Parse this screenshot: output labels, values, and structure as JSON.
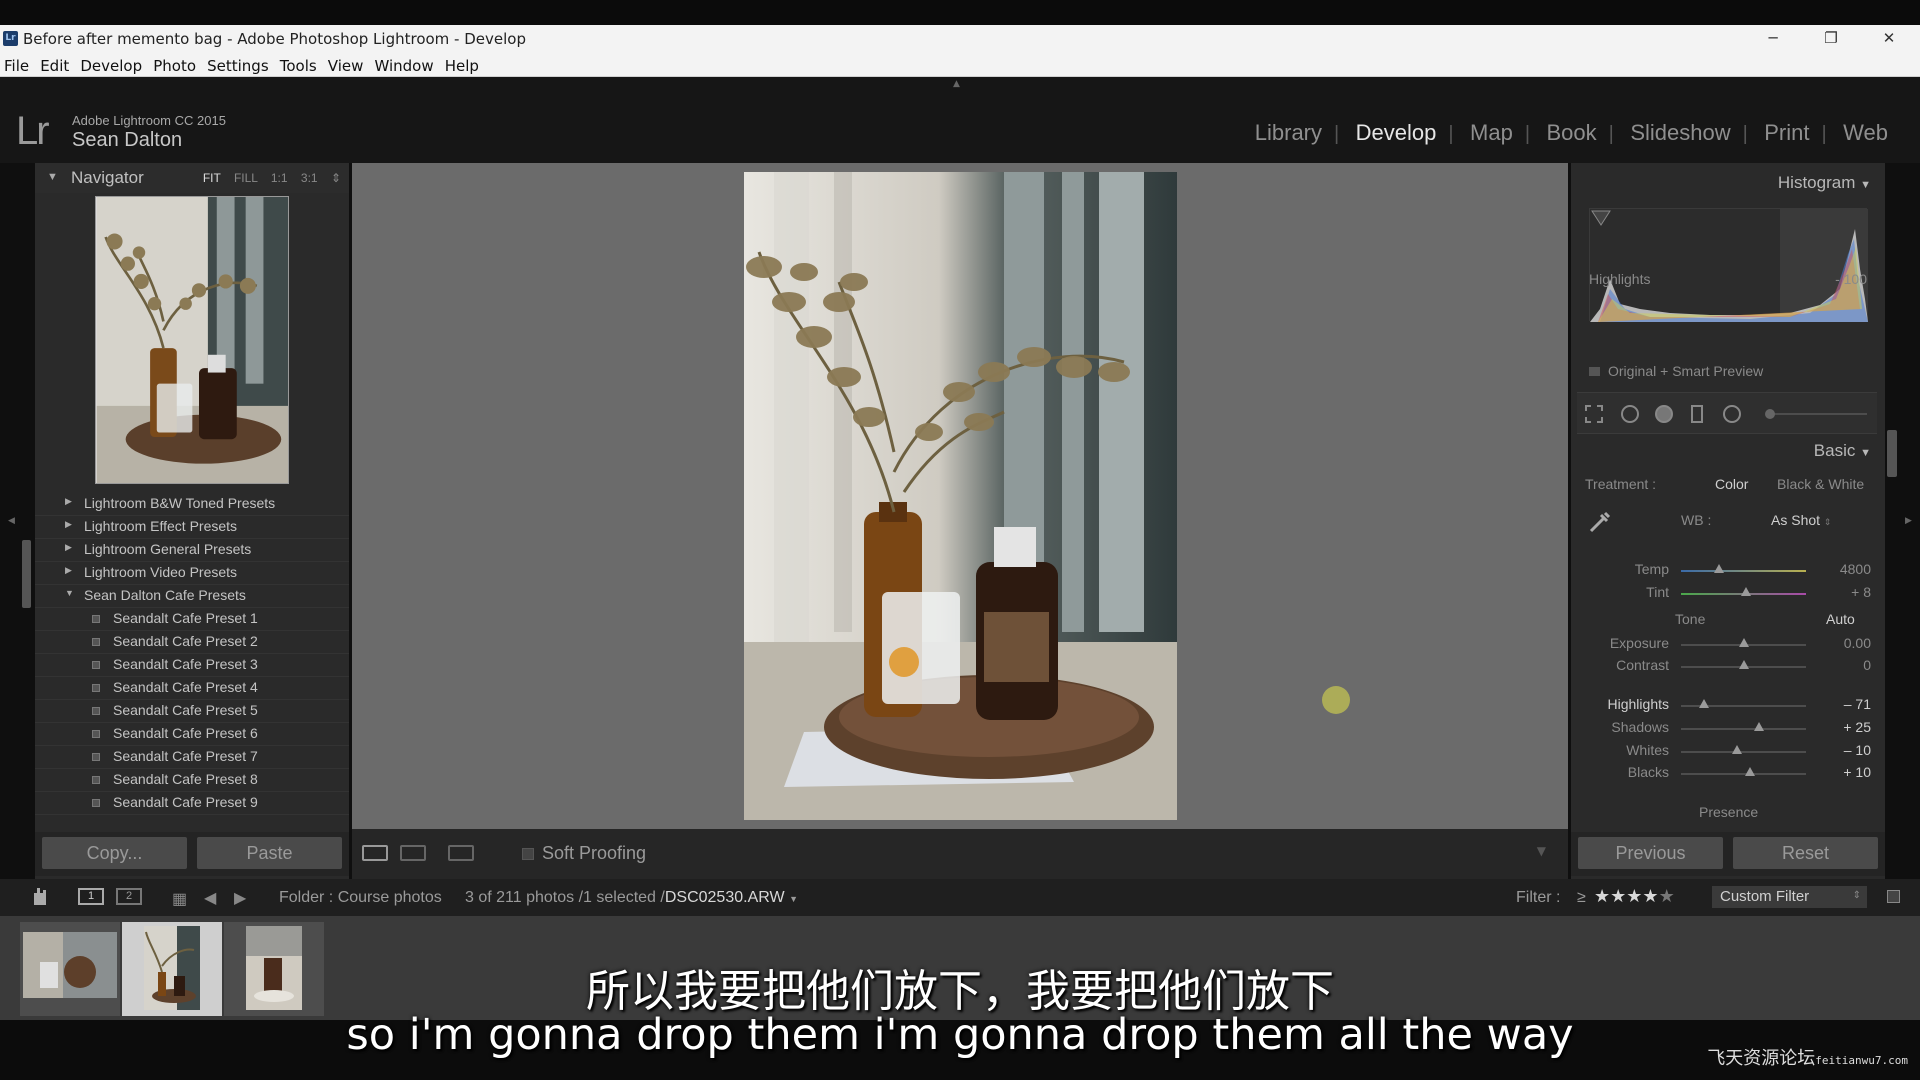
{
  "window": {
    "title": "Before after memento bag - Adobe Photoshop Lightroom - Develop",
    "app_icon": "Lr",
    "minimize": "─",
    "restore": "❐",
    "close": "✕"
  },
  "menu": [
    "File",
    "Edit",
    "Develop",
    "Photo",
    "Settings",
    "Tools",
    "View",
    "Window",
    "Help"
  ],
  "identity": {
    "logo": "Lr",
    "product": "Adobe Lightroom CC 2015",
    "user": "Sean Dalton"
  },
  "modules": {
    "items": [
      "Library",
      "Develop",
      "Map",
      "Book",
      "Slideshow",
      "Print",
      "Web"
    ],
    "active": "Develop"
  },
  "navigator": {
    "title": "Navigator",
    "zoom_options": [
      "FIT",
      "FILL",
      "1:1",
      "3:1"
    ],
    "active_zoom": "FIT"
  },
  "presets": {
    "folders": [
      {
        "label": "Lightroom B&W Toned Presets",
        "expanded": false
      },
      {
        "label": "Lightroom Effect Presets",
        "expanded": false
      },
      {
        "label": "Lightroom General Presets",
        "expanded": false
      },
      {
        "label": "Lightroom Video Presets",
        "expanded": false
      },
      {
        "label": "Sean Dalton Cafe Presets",
        "expanded": true
      }
    ],
    "items": [
      "Seandalt Cafe Preset 1",
      "Seandalt Cafe Preset 2",
      "Seandalt Cafe Preset 3",
      "Seandalt Cafe Preset 4",
      "Seandalt Cafe Preset 5",
      "Seandalt Cafe Preset 6",
      "Seandalt Cafe Preset 7",
      "Seandalt Cafe Preset 8",
      "Seandalt Cafe Preset 9"
    ]
  },
  "left_buttons": {
    "copy": "Copy...",
    "paste": "Paste"
  },
  "toolbar": {
    "soft_proofing": "Soft Proofing"
  },
  "histogram": {
    "title": "Histogram",
    "hover_label": "Highlights",
    "hover_value": "- 100",
    "preview_label": "Original + Smart Preview"
  },
  "basic": {
    "title": "Basic",
    "treatment_label": "Treatment :",
    "treatment_color": "Color",
    "treatment_bw": "Black & White",
    "wb_label": "WB :",
    "wb_value": "As Shot",
    "tone_label": "Tone",
    "auto_label": "Auto",
    "presence_label": "Presence",
    "sliders": [
      {
        "label": "Temp",
        "value": "4800",
        "position": 0.3,
        "highlight": false
      },
      {
        "label": "Tint",
        "value": "+ 8",
        "position": 0.52,
        "highlight": false
      },
      {
        "label": "Exposure",
        "value": "0.00",
        "position": 0.5,
        "highlight": false
      },
      {
        "label": "Contrast",
        "value": "0",
        "position": 0.5,
        "highlight": false
      },
      {
        "label": "Highlights",
        "value": "– 71",
        "position": 0.18,
        "highlight": true
      },
      {
        "label": "Shadows",
        "value": "+ 25",
        "position": 0.62,
        "highlight": false
      },
      {
        "label": "Whites",
        "value": "– 10",
        "position": 0.45,
        "highlight": false
      },
      {
        "label": "Blacks",
        "value": "+ 10",
        "position": 0.55,
        "highlight": false
      }
    ]
  },
  "right_buttons": {
    "previous": "Previous",
    "reset": "Reset"
  },
  "filmstrip": {
    "folder": "Folder : Course photos",
    "count": "3 of 211 photos /1 selected /",
    "filename": "DSC02530.ARW",
    "filter_label": "Filter :",
    "filter_op": "≥",
    "stars": 4,
    "custom_filter": "Custom Filter",
    "page1": "1",
    "page2": "2"
  },
  "subtitles": {
    "chinese": "所以我要把他们放下，我要把他们放下",
    "english": "so i'm gonna drop them i'm gonna drop them all the way"
  },
  "watermark": {
    "main": "飞天资源论坛",
    "sub": "feitianwu7.com"
  },
  "colors": {
    "accent": "#d8d8d8",
    "panel": "#2a2a2a",
    "canvas": "#6b6b6b"
  }
}
